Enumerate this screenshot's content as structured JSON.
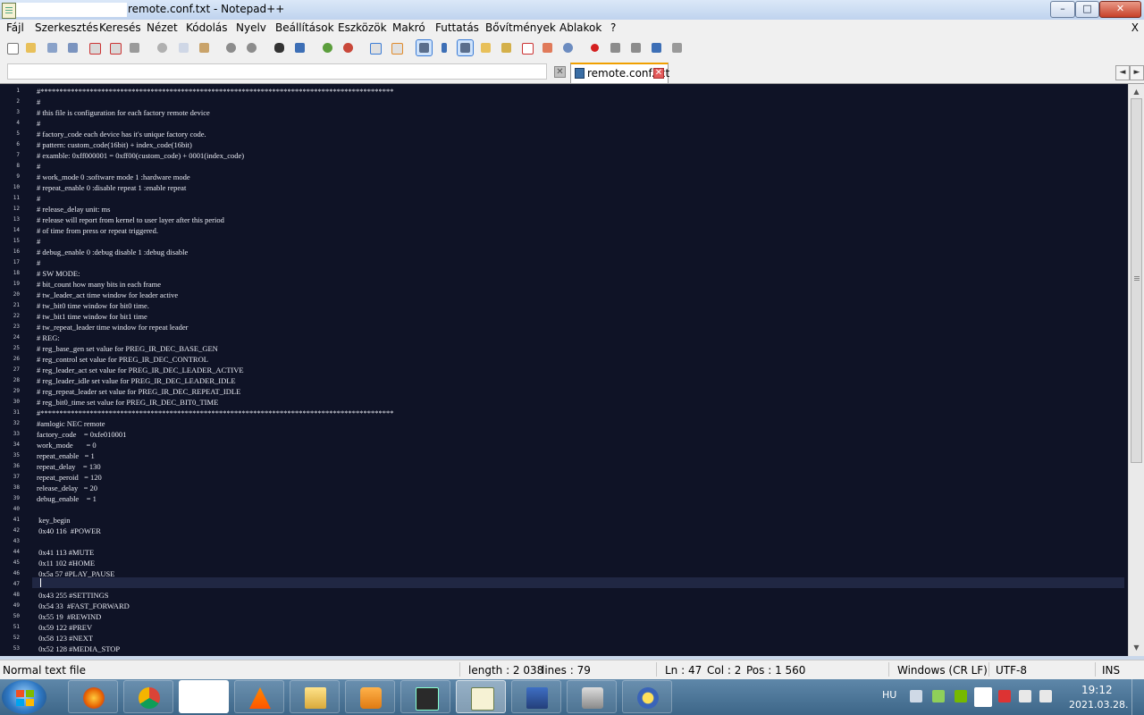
{
  "window": {
    "title": "remote.conf.txt - Notepad++",
    "controls": [
      "–",
      "□",
      "✕"
    ]
  },
  "menu": [
    "Fájl",
    "Szerkesztés",
    "Keresés",
    "Nézet",
    "Kódolás",
    "Nyelv",
    "Beállítások",
    "Eszközök",
    "Makró",
    "Futtatás",
    "Bővítmények",
    "Ablakok",
    "?"
  ],
  "menu_close": "X",
  "tabs": {
    "active_label": "remote.conf.txt",
    "close_glyph": "✕",
    "nav_left": "◄",
    "nav_right": "►"
  },
  "editor": {
    "line_numbers": [
      "1",
      "2",
      "3",
      "4",
      "5",
      "6",
      "7",
      "8",
      "9",
      "10",
      "11",
      "12",
      "13",
      "14",
      "15",
      "16",
      "17",
      "18",
      "19",
      "20",
      "21",
      "22",
      "23",
      "24",
      "25",
      "26",
      "27",
      "28",
      "29",
      "30",
      "31",
      "32",
      "33",
      "34",
      "35",
      "36",
      "37",
      "38",
      "39",
      "40",
      "41",
      "42",
      "43",
      "44",
      "45",
      "46",
      "47",
      "48",
      "49",
      "50",
      "51",
      "52",
      "53"
    ],
    "lines": [
      "#*********************************************************************************************",
      "#",
      "# this file is configuration for each factory remote device",
      "#",
      "# factory_code each device has it's unique factory code.",
      "# pattern: custom_code(16bit) + index_code(16bit)",
      "# examble: 0xff000001 = 0xff00(custom_code) + 0001(index_code)",
      "#",
      "# work_mode 0 :software mode 1 :hardware mode",
      "# repeat_enable 0 :disable repeat 1 :enable repeat",
      "#",
      "# release_delay unit: ms",
      "# release will report from kernel to user layer after this period",
      "# of time from press or repeat triggered.",
      "#",
      "# debug_enable 0 :debug disable 1 :debug disable",
      "#",
      "# SW MODE:",
      "# bit_count how many bits in each frame",
      "# tw_leader_act time window for leader active",
      "# tw_bit0 time window for bit0 time.",
      "# tw_bit1 time window for bit1 time",
      "# tw_repeat_leader time window for repeat leader",
      "# REG:",
      "# reg_base_gen set value for PREG_IR_DEC_BASE_GEN",
      "# reg_control set value for PREG_IR_DEC_CONTROL",
      "# reg_leader_act set value for PREG_IR_DEC_LEADER_ACTIVE",
      "# reg_leader_idle set value for PREG_IR_DEC_LEADER_IDLE",
      "# reg_repeat_leader set value for PREG_IR_DEC_REPEAT_IDLE",
      "# reg_bit0_time set value for PREG_IR_DEC_BIT0_TIME",
      "#*********************************************************************************************",
      "#amlogic NEC remote",
      "factory_code    = 0xfe010001",
      "work_mode       = 0",
      "repeat_enable   = 1",
      "repeat_delay    = 130",
      "repeat_peroid   = 120",
      "release_delay   = 20",
      "debug_enable    = 1",
      "",
      " key_begin",
      " 0x40 116  #POWER",
      "",
      " 0x41 113 #MUTE",
      " 0x11 102 #HOME",
      " 0x5a 57 #PLAY_PAUSE",
      "",
      " 0x43 255 #SETTINGS",
      " 0x54 33  #FAST_FORWARD",
      " 0x55 19  #REWIND",
      " 0x59 122 #PREV",
      " 0x58 123 #NEXT",
      " 0x52 128 #MEDIA_STOP"
    ],
    "current_line": 47
  },
  "status": {
    "file_type": "Normal text file",
    "length": "length : 2 038",
    "lines": "lines : 79",
    "ln": "Ln : 47",
    "col": "Col : 2",
    "pos": "Pos : 1 560",
    "eol": "Windows (CR LF)",
    "encoding": "UTF-8",
    "mode": "INS"
  },
  "taskbar": {
    "lang": "HU",
    "time": "19:12",
    "date": "2021.03.28."
  },
  "colors": {
    "editor_bg": "#0f1326",
    "editor_text": "#e8eaf2",
    "active_tab_accent": "#f0a000"
  }
}
